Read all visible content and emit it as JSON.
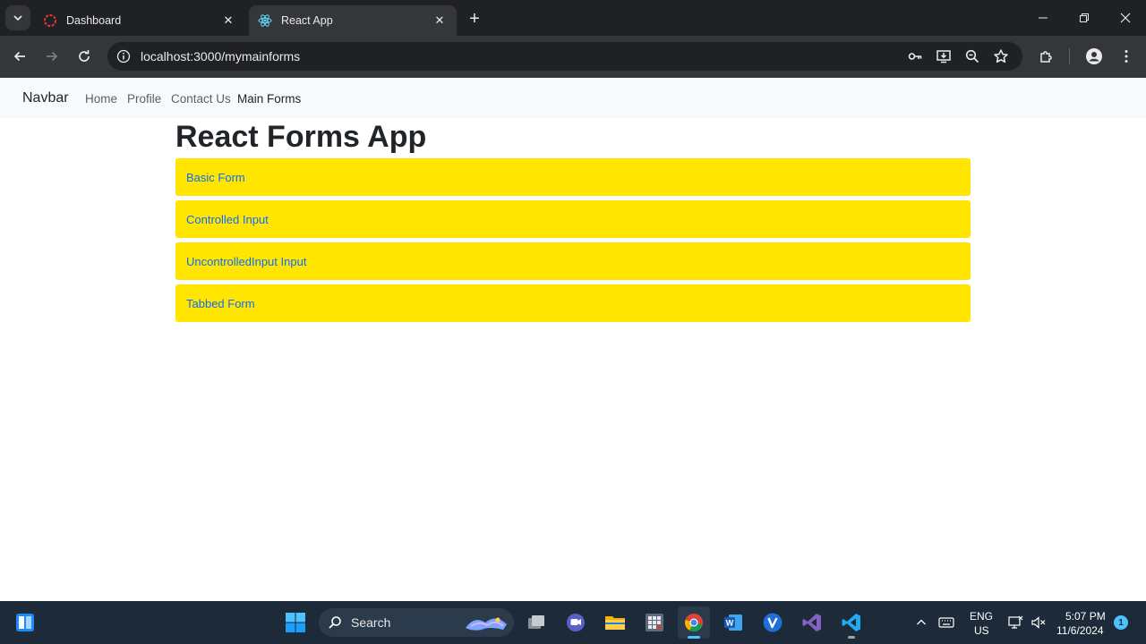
{
  "browser": {
    "tabs": [
      {
        "title": "Dashboard",
        "active": false,
        "favicon": "red-ring-icon"
      },
      {
        "title": "React App",
        "active": true,
        "favicon": "react-icon"
      }
    ],
    "url": "localhost:3000/mymainforms"
  },
  "navbar": {
    "brand": "Navbar",
    "links": [
      {
        "label": "Home"
      },
      {
        "label": "Profile"
      },
      {
        "label": "Contact Us"
      },
      {
        "label": "Main Forms"
      }
    ]
  },
  "main": {
    "title": "React Forms App",
    "forms": [
      {
        "label": "Basic Form"
      },
      {
        "label": "Controlled Input"
      },
      {
        "label": "UncontrolledInput Input"
      },
      {
        "label": "Tabbed Form"
      }
    ],
    "item_color": "#ffe500",
    "link_color": "#0d6efd"
  },
  "taskbar": {
    "search_label": "Search",
    "language": "ENG",
    "region": "US",
    "time": "5:07 PM",
    "date": "11/6/2024",
    "notification_count": "1"
  }
}
